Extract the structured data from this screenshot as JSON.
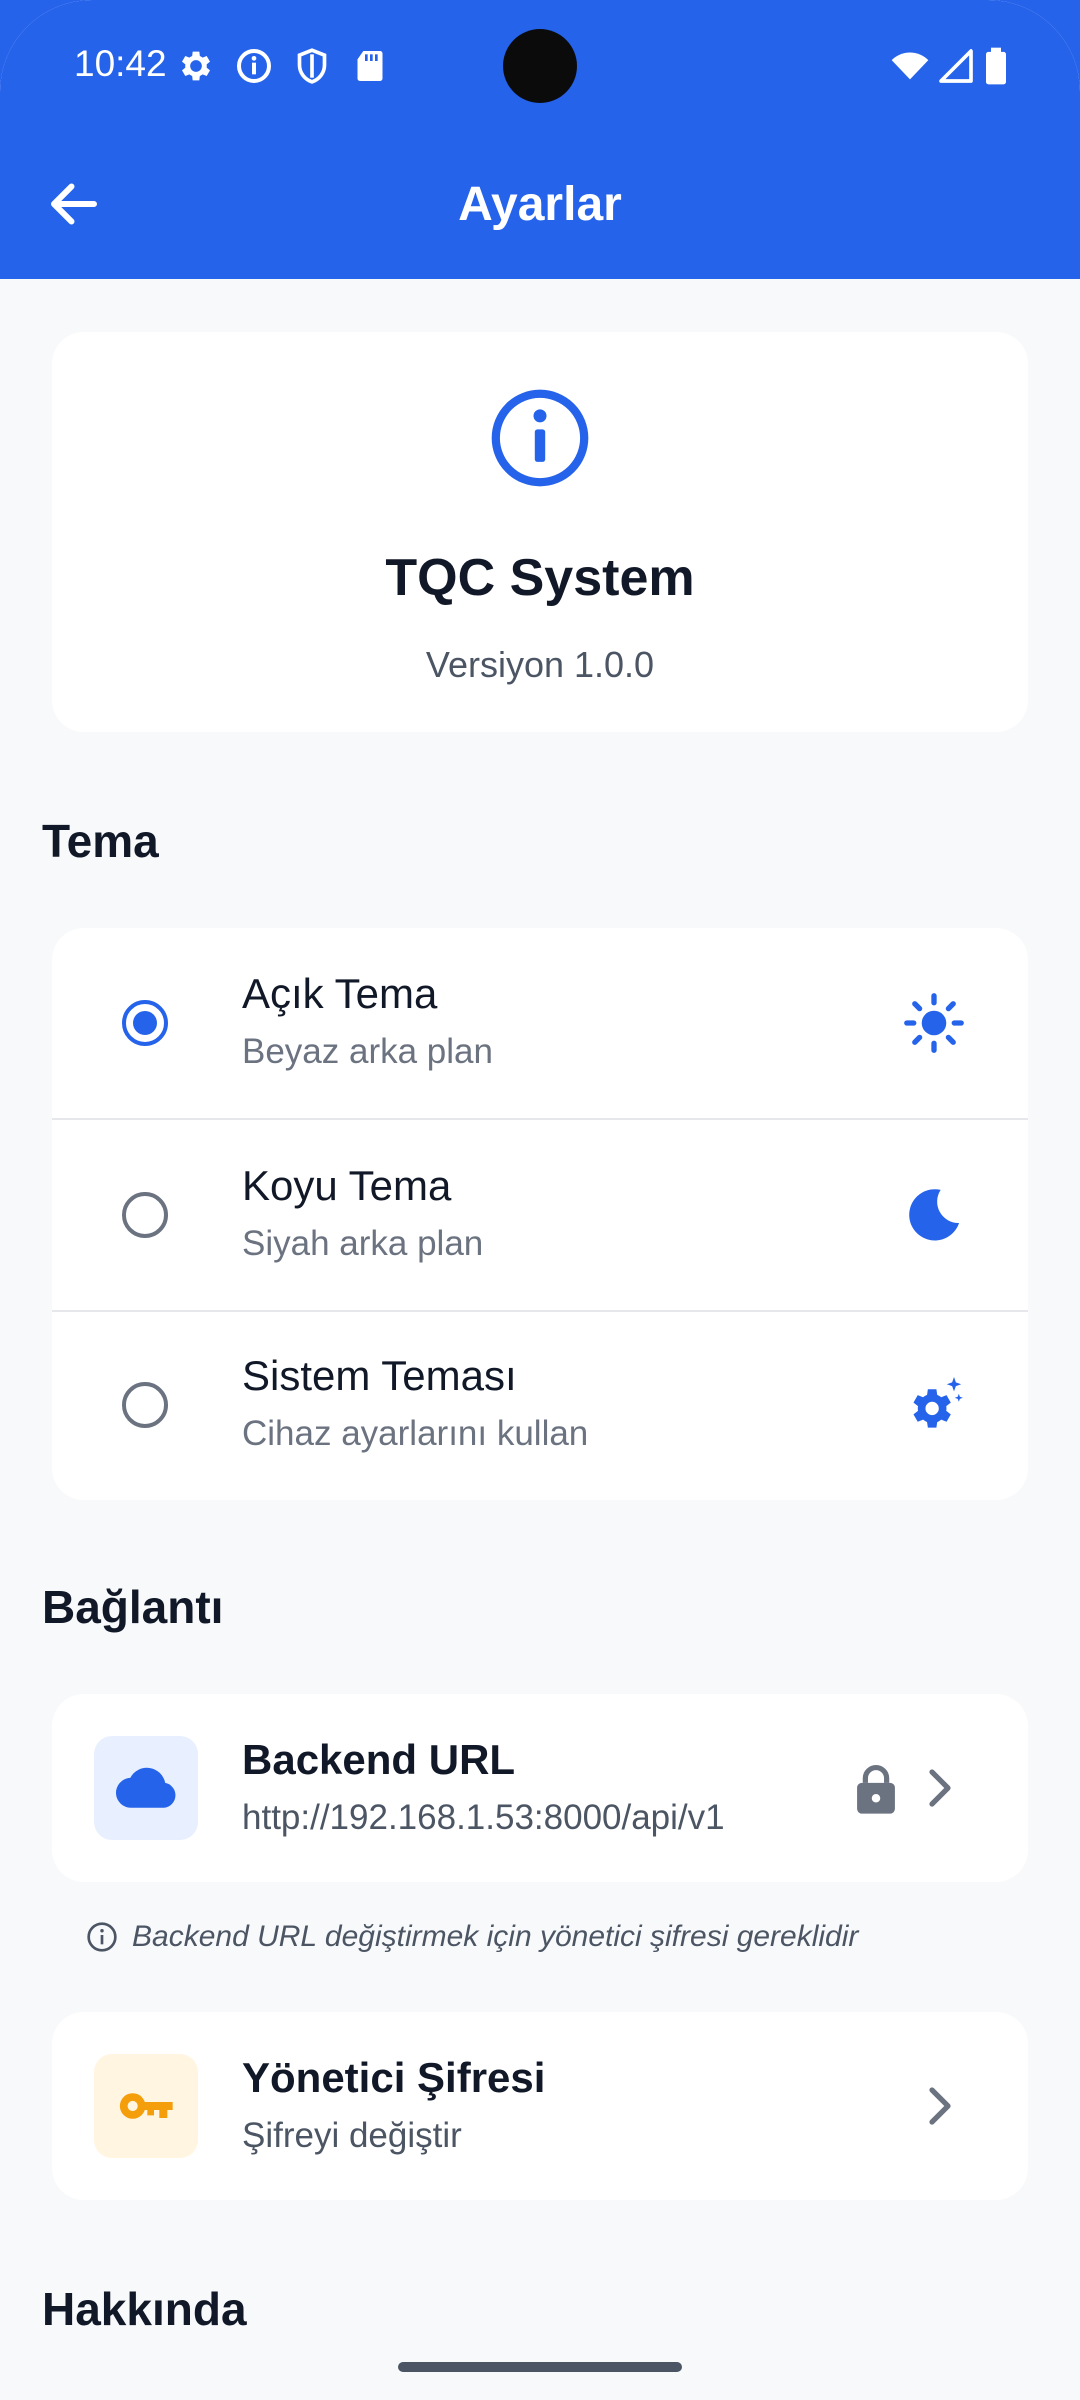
{
  "status_bar": {
    "time": "10:42",
    "icons": [
      "settings-icon",
      "info-icon",
      "shield-icon",
      "sd-card-icon",
      "wifi-icon",
      "signal-icon",
      "battery-icon"
    ]
  },
  "app_bar": {
    "title": "Ayarlar",
    "back_icon": "arrow-left-icon",
    "color": "#2563eb"
  },
  "info_card": {
    "icon": "info-icon",
    "app_name": "TQC System",
    "version": "Versiyon 1.0.0"
  },
  "theme_section": {
    "title": "Tema",
    "options": [
      {
        "title": "Açık Tema",
        "subtitle": "Beyaz arka plan",
        "icon": "sun-icon",
        "selected": true
      },
      {
        "title": "Koyu Tema",
        "subtitle": "Siyah arka plan",
        "icon": "moon-icon",
        "selected": false
      },
      {
        "title": "Sistem Teması",
        "subtitle": "Cihaz ayarlarını kullan",
        "icon": "gear-sparkle-icon",
        "selected": false
      }
    ]
  },
  "connection_section": {
    "title": "Bağlantı",
    "backend": {
      "title": "Backend URL",
      "value": "http://192.168.1.53:8000/api/v1",
      "icon": "cloud-icon",
      "locked": true
    },
    "hint": "Backend URL değiştirmek için yönetici şifresi gereklidir",
    "admin": {
      "title": "Yönetici Şifresi",
      "subtitle": "Şifreyi değiştir",
      "icon": "key-icon"
    }
  },
  "about_section": {
    "title": "Hakkında"
  },
  "colors": {
    "accent": "#2563eb",
    "key_amber": "#f59e0b"
  }
}
